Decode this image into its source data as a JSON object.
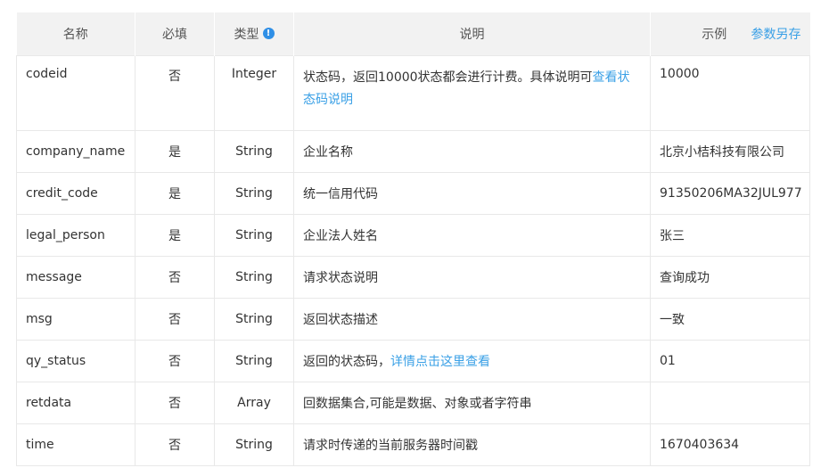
{
  "header": {
    "name": "名称",
    "required": "必填",
    "type": "类型",
    "type_info_glyph": "!",
    "description": "说明",
    "example": "示例",
    "save_params": "参数另存"
  },
  "rows": [
    {
      "name": "codeid",
      "required": "否",
      "type": "Integer",
      "desc": "状态码，返回10000状态都会进行计费。具体说明可",
      "desc_link": "查看状态码说明",
      "example": "10000"
    },
    {
      "name": "company_name",
      "required": "是",
      "type": "String",
      "desc": "企业名称",
      "desc_link": "",
      "example": "北京小桔科技有限公司"
    },
    {
      "name": "credit_code",
      "required": "是",
      "type": "String",
      "desc": "统一信用代码",
      "desc_link": "",
      "example": "91350206MA32JUL977"
    },
    {
      "name": "legal_person",
      "required": "是",
      "type": "String",
      "desc": "企业法人姓名",
      "desc_link": "",
      "example": "张三"
    },
    {
      "name": "message",
      "required": "否",
      "type": "String",
      "desc": "请求状态说明",
      "desc_link": "",
      "example": "查询成功"
    },
    {
      "name": "msg",
      "required": "否",
      "type": "String",
      "desc": "返回状态描述",
      "desc_link": "",
      "example": "一致"
    },
    {
      "name": "qy_status",
      "required": "否",
      "type": "String",
      "desc": "返回的状态码，",
      "desc_link": "详情点击这里查看",
      "example": "01"
    },
    {
      "name": "retdata",
      "required": "否",
      "type": "Array",
      "desc": "回数据集合,可能是数据、对象或者字符串",
      "desc_link": "",
      "example": ""
    },
    {
      "name": "time",
      "required": "否",
      "type": "String",
      "desc": "请求时传递的当前服务器时间戳",
      "desc_link": "",
      "example": "1670403634"
    }
  ],
  "colors": {
    "link": "#3aa0e6",
    "header_bg": "#f2f2f2",
    "info_icon": "#2f8fe6"
  }
}
